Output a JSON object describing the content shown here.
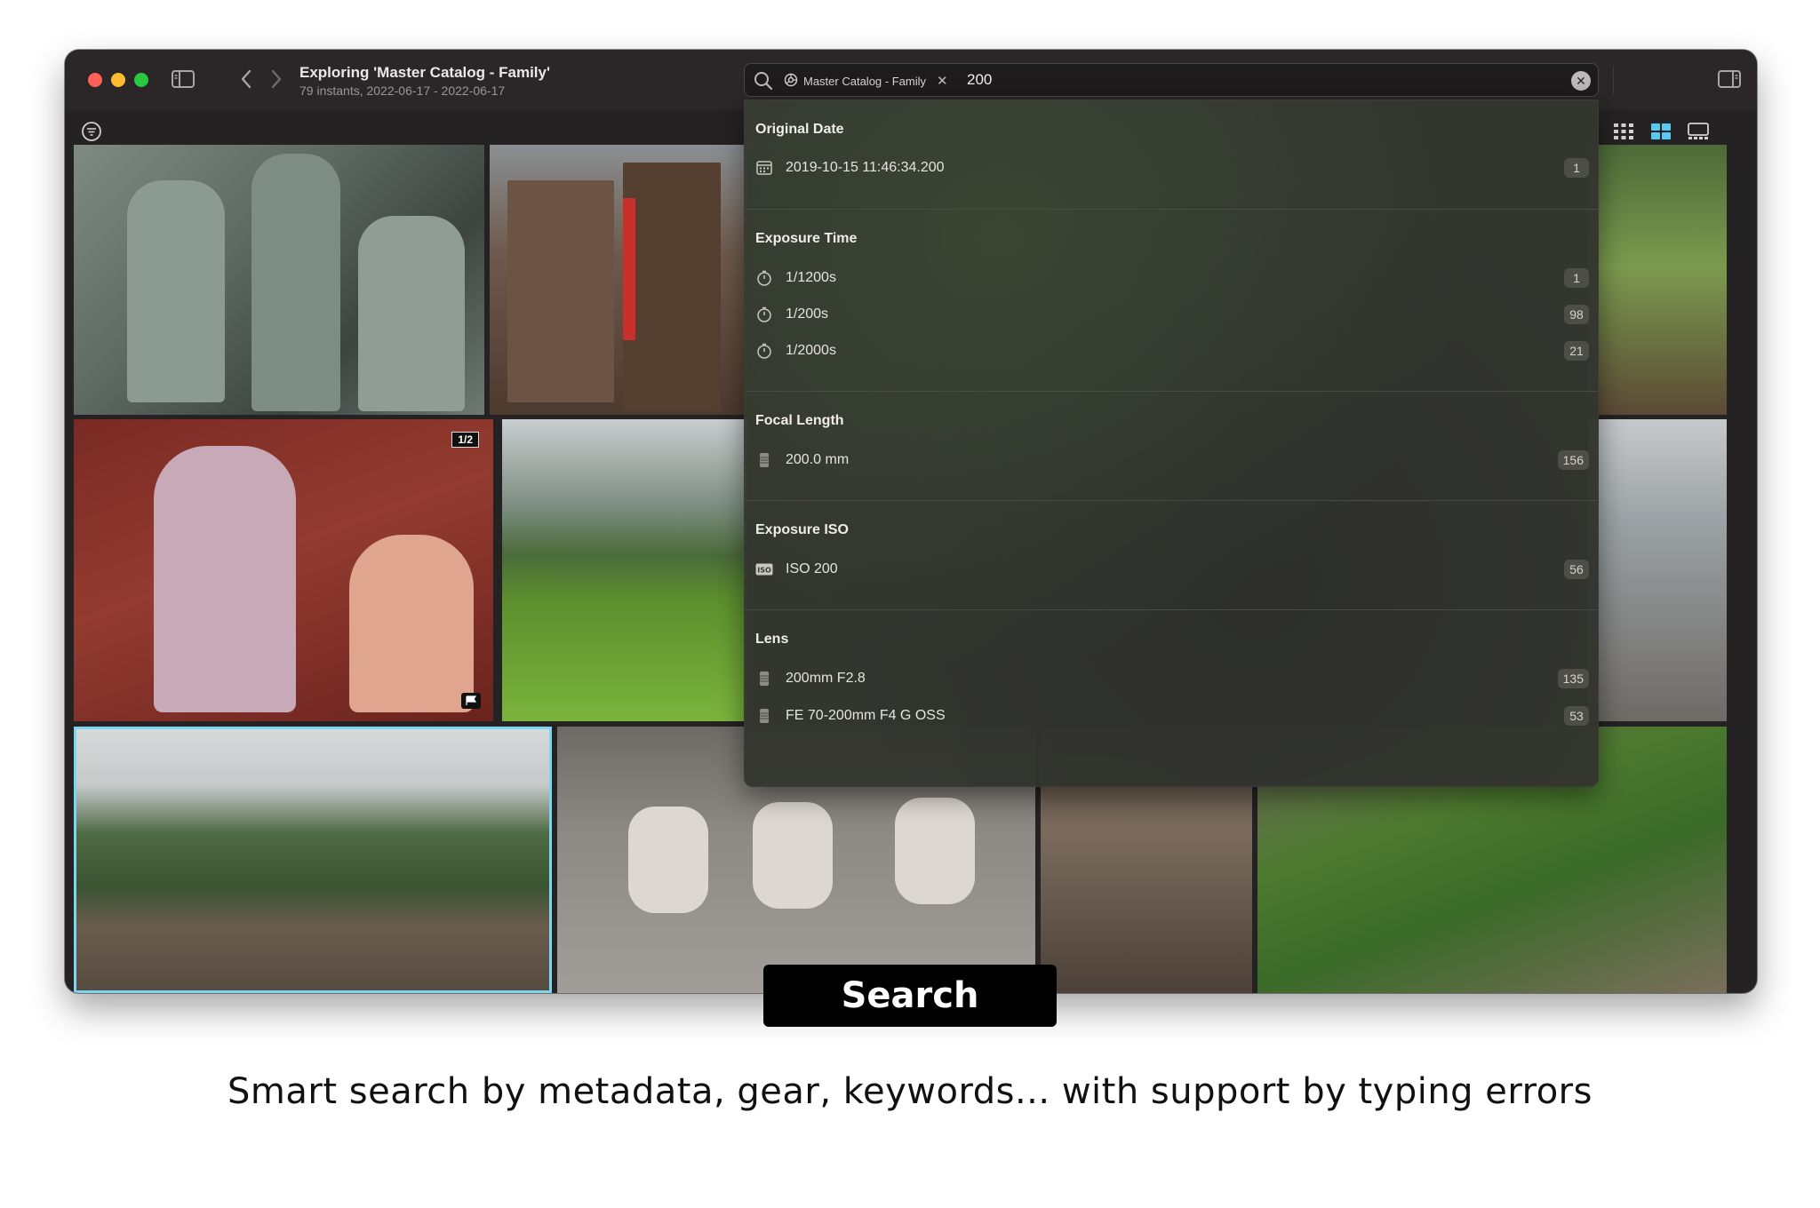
{
  "window": {
    "title": "Exploring 'Master Catalog - Family'",
    "subtitle": "79 instants, 2022-06-17 - 2022-06-17"
  },
  "search": {
    "token_label": "Master Catalog - Family",
    "query": "200"
  },
  "photos": {
    "stack_badge": "1/2"
  },
  "results": {
    "sections": [
      {
        "title": "Original Date",
        "items": [
          {
            "icon": "calendar-icon",
            "label": "2019-10-15 11:46:34.200",
            "count": "1"
          }
        ]
      },
      {
        "title": "Exposure Time",
        "items": [
          {
            "icon": "timer-icon",
            "label": "1/1200s",
            "count": "1"
          },
          {
            "icon": "timer-icon",
            "label": "1/200s",
            "count": "98"
          },
          {
            "icon": "timer-icon",
            "label": "1/2000s",
            "count": "21"
          }
        ]
      },
      {
        "title": "Focal Length",
        "items": [
          {
            "icon": "lens-icon",
            "label": "200.0 mm",
            "count": "156"
          }
        ]
      },
      {
        "title": "Exposure ISO",
        "items": [
          {
            "icon": "iso-icon",
            "label": "ISO 200",
            "count": "56"
          }
        ]
      },
      {
        "title": "Lens",
        "items": [
          {
            "icon": "lens-icon",
            "label": "200mm F2.8",
            "count": "135"
          },
          {
            "icon": "lens-icon",
            "label": "FE 70-200mm F4 G OSS",
            "count": "53"
          }
        ]
      }
    ]
  },
  "promo": {
    "label": "Search",
    "caption": "Smart search by metadata, gear, keywords... with support by typing errors"
  }
}
